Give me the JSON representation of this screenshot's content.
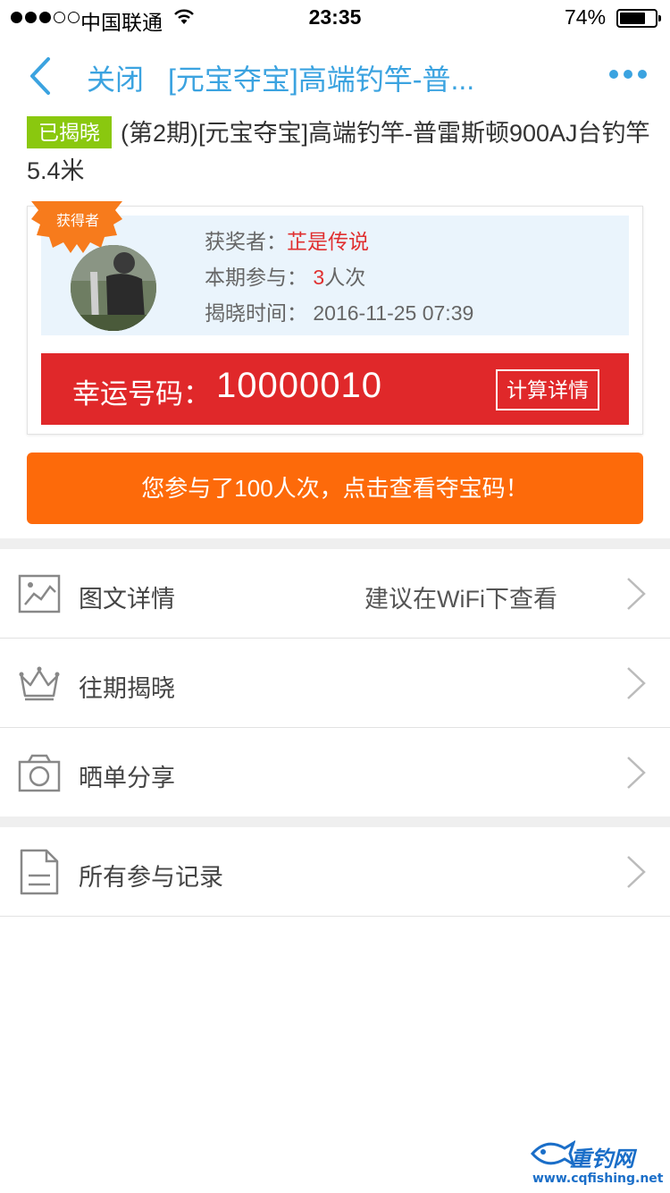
{
  "status_bar": {
    "carrier": "中国联通",
    "time": "23:35",
    "battery_percent": "74%",
    "battery_level": 0.74,
    "signal_bars": 3
  },
  "nav": {
    "close_label": "关闭",
    "title": "[元宝夺宝]高端钓竿-普...",
    "accent_color": "#3ba3e0"
  },
  "product": {
    "badge": "已揭晓",
    "title": "(第2期)[元宝夺宝]高端钓竿-普雷斯顿900AJ台钓竿5.4米"
  },
  "winner": {
    "ribbon_label": "获得者",
    "winner_label": "获奖者：",
    "winner_name": "芷是传说",
    "participation_label": "本期参与：",
    "participation_count": "3",
    "participation_unit": "人次",
    "reveal_time_label": "揭晓时间：",
    "reveal_time": "2016-11-25 07:39"
  },
  "lucky": {
    "label": "幸运号码：",
    "number": "10000010",
    "calc_button": "计算详情"
  },
  "participate_button": "您参与了100人次，点击查看夺宝码！",
  "list": {
    "detail": {
      "label": "图文详情",
      "hint": "建议在WiFi下查看",
      "icon": "image-icon"
    },
    "history": {
      "label": "往期揭晓",
      "icon": "crown-icon"
    },
    "share": {
      "label": "晒单分享",
      "icon": "camera-icon"
    },
    "records": {
      "label": "所有参与记录",
      "icon": "document-icon"
    }
  },
  "watermark": {
    "text": "重钓网",
    "url": "www.cqfishing.net"
  }
}
